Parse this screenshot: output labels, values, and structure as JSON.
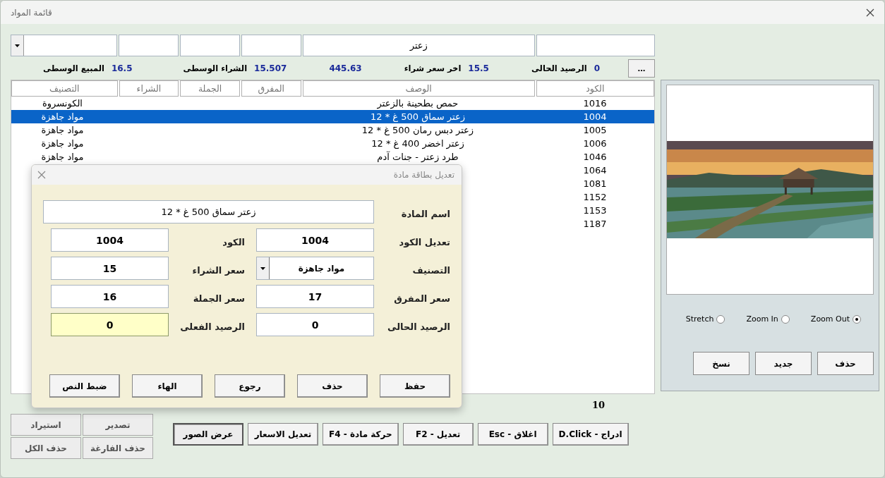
{
  "window": {
    "title": "قائمة المواد"
  },
  "filter": {
    "description_value": "زعتر"
  },
  "more_button": "...",
  "summary": [
    {
      "label": "الرصيد الحالى",
      "value": "0"
    },
    {
      "label": "اخر سعر شراء",
      "value": "15.5"
    },
    {
      "value": "445.63"
    },
    {
      "label": "الشراء الوسطى",
      "value": "15.507"
    },
    {
      "label": "المبيع الوسطى",
      "value": "16.5"
    }
  ],
  "table": {
    "columns": [
      "الكود",
      "الوصف",
      "المفرق",
      "الجملة",
      "الشراء",
      "التصنيف"
    ],
    "rows": [
      {
        "code": "1016",
        "description": "حمص بطحينة بالزعتر",
        "category": "الكونسروة",
        "selected": false
      },
      {
        "code": "1004",
        "description": "زعتر سماق 500 غ * 12",
        "category": "مواد جاهزة",
        "selected": true
      },
      {
        "code": "1005",
        "description": "زعتر دبس رمان 500 غ * 12",
        "category": "مواد جاهزة",
        "selected": false
      },
      {
        "code": "1006",
        "description": "زعتر اخضر 400 غ * 12",
        "category": "مواد جاهزة",
        "selected": false
      },
      {
        "code": "1046",
        "description": "طرد زعتر - جنات آدم",
        "category": "مواد جاهزة",
        "selected": false
      },
      {
        "code": "1064",
        "selected": false
      },
      {
        "code": "1081",
        "selected": false
      },
      {
        "code": "1152",
        "selected": false
      },
      {
        "code": "1153",
        "selected": false
      },
      {
        "code": "1187",
        "selected": false
      }
    ]
  },
  "record_count": "10",
  "side_buttons": [
    "تصدير",
    "استيراد",
    "حذف الفارغة",
    "حذف الكل"
  ],
  "actions": [
    {
      "label": "ادراج - D.Click",
      "selected": false
    },
    {
      "label": "اغلاق - Esc",
      "selected": false
    },
    {
      "label": "تعديل - F2",
      "selected": false
    },
    {
      "label": "حركة مادة - F4",
      "selected": false
    },
    {
      "label": "تعديل الاسعار",
      "selected": false
    },
    {
      "label": "عرض الصور",
      "selected": true
    }
  ],
  "image_panel": {
    "options": [
      {
        "label": "Zoom Out",
        "selected": true
      },
      {
        "label": "Zoom In",
        "selected": false
      },
      {
        "label": "Stretch",
        "selected": false
      }
    ],
    "buttons": [
      "حذف",
      "جديد",
      "نسخ"
    ]
  },
  "dialog": {
    "title": "تعديل بطاقة مادة",
    "fields": [
      {
        "label": "اسم المادة",
        "value": "زعتر سماق 500 غ * 12",
        "kind": "wide",
        "focused": false
      },
      {
        "label": "تعديل الكود",
        "value": "1004",
        "kind": "text",
        "focused": false
      },
      {
        "label": "الكود",
        "value": "1004",
        "kind": "text",
        "focused": false
      },
      {
        "label": "التصنيف",
        "value": "مواد جاهزة",
        "kind": "dropdown",
        "focused": false
      },
      {
        "label": "سعر الشراء",
        "value": "15",
        "kind": "text",
        "focused": false
      },
      {
        "label": "سعر المفرق",
        "value": "17",
        "kind": "text",
        "focused": false
      },
      {
        "label": "سعر الجملة",
        "value": "16",
        "kind": "text",
        "focused": false
      },
      {
        "label": "الرصيد الحالى",
        "value": "0",
        "kind": "text",
        "focused": false
      },
      {
        "label": "الرصيد الفعلى",
        "value": "0",
        "kind": "text",
        "focused": true
      }
    ],
    "buttons": [
      "حفظ",
      "حذف",
      "رجوع",
      "الهاء",
      "ضبط النص"
    ]
  }
}
